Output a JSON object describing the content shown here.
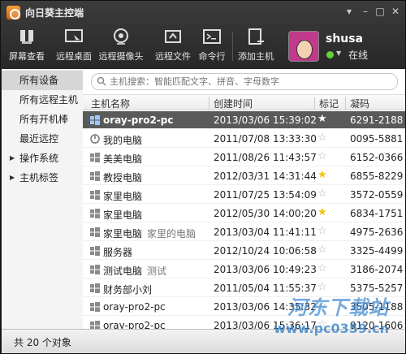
{
  "window": {
    "title": "向日葵主控端",
    "controls": [
      "▾",
      "–",
      "□",
      "✕"
    ]
  },
  "toolbar": [
    {
      "label": "屏幕查看",
      "icon": "screen-view-icon"
    },
    {
      "label": "远程桌面",
      "icon": "remote-desktop-icon"
    },
    {
      "label": "远程摄像头",
      "icon": "remote-camera-icon"
    },
    {
      "label": "远程文件",
      "icon": "remote-file-icon"
    },
    {
      "label": "命令行",
      "icon": "command-line-icon"
    },
    {
      "label": "添加主机",
      "icon": "add-host-icon"
    }
  ],
  "user": {
    "name": "shusa",
    "status": "在线",
    "status_color": "#62d23b"
  },
  "sidebar": {
    "items": [
      {
        "label": "所有设备",
        "active": true,
        "expandable": false
      },
      {
        "label": "所有远程主机",
        "active": false,
        "expandable": false
      },
      {
        "label": "所有开机棒",
        "active": false,
        "expandable": false
      },
      {
        "label": "最近远控",
        "active": false,
        "expandable": false
      },
      {
        "label": "操作系统",
        "active": false,
        "expandable": true
      },
      {
        "label": "主机标签",
        "active": false,
        "expandable": true
      }
    ]
  },
  "search": {
    "placeholder": "主机搜索：智能匹配文字、拼音、字母数字"
  },
  "table": {
    "columns": [
      "主机名称",
      "创建时间",
      "标记",
      "凝码"
    ],
    "rows": [
      {
        "name": "oray-pro2-pc",
        "note": "",
        "time": "2013/03/06 15:39:02",
        "star": "★",
        "code": "6291-2188",
        "icon": "windows-icon",
        "selected": true
      },
      {
        "name": "我的电脑",
        "note": "",
        "time": "2011/07/08 13:33:30",
        "star": "☆",
        "code": "0095-5881",
        "icon": "power-icon",
        "selected": false
      },
      {
        "name": "美美电脑",
        "note": "",
        "time": "2011/08/26 11:43:57",
        "star": "☆",
        "code": "6152-0366",
        "icon": "windows-icon",
        "selected": false
      },
      {
        "name": "教授电脑",
        "note": "",
        "time": "2012/03/31 14:31:44",
        "star": "★",
        "code": "6855-8229",
        "icon": "windows-icon",
        "selected": false
      },
      {
        "name": "家里电脑",
        "note": "",
        "time": "2011/07/25 13:54:09",
        "star": "☆",
        "code": "3572-0559",
        "icon": "windows-icon",
        "selected": false
      },
      {
        "name": "家里电脑",
        "note": "",
        "time": "2012/05/30 14:00:20",
        "star": "★",
        "code": "6834-1751",
        "icon": "windows-icon",
        "selected": false
      },
      {
        "name": "家里电脑",
        "note": "家里的电脑",
        "time": "2013/03/04 11:41:11",
        "star": "☆",
        "code": "4975-2636",
        "icon": "windows-icon",
        "selected": false
      },
      {
        "name": "服务器",
        "note": "",
        "time": "2012/10/24 10:06:58",
        "star": "☆",
        "code": "3325-4499",
        "icon": "windows-icon",
        "selected": false
      },
      {
        "name": "测试电脑",
        "note": "测试",
        "time": "2013/03/06 10:49:23",
        "star": "☆",
        "code": "3186-2074",
        "icon": "windows-icon",
        "selected": false
      },
      {
        "name": "财务部小刘",
        "note": "",
        "time": "2011/05/04 11:55:37",
        "star": "☆",
        "code": "5375-5257",
        "icon": "windows-icon",
        "selected": false
      },
      {
        "name": "oray-pro2-pc",
        "note": "",
        "time": "2013/03/06 14:35:32",
        "star": "☆",
        "code": "3505-1188",
        "icon": "windows-icon",
        "selected": false
      },
      {
        "name": "oray-pro2-pc",
        "note": "",
        "time": "2013/03/06 15:36:17",
        "star": "☆",
        "code": "9120-1606",
        "icon": "windows-icon",
        "selected": false
      }
    ],
    "star_filled_color": "#f1c40f"
  },
  "status_bar": {
    "text": "共 20 个对象"
  },
  "watermark": {
    "text": "河东下载站",
    "url": "www.pc0359.cn"
  }
}
